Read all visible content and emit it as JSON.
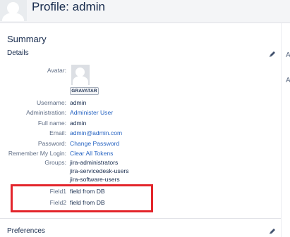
{
  "header": {
    "title": "Profile: admin",
    "avatar_icon": "user-avatar-icon"
  },
  "summary": {
    "heading": "Summary"
  },
  "details": {
    "heading": "Details",
    "edit_icon": "pencil-icon",
    "avatar_label": "Avatar:",
    "gravatar_button": "GRAVATAR",
    "username_label": "Username:",
    "username_value": "admin",
    "administration_label": "Administration:",
    "administration_value": "Administer User",
    "fullname_label": "Full name:",
    "fullname_value": "admin",
    "email_label": "Email:",
    "email_value": "admin@admin.com",
    "password_label": "Password:",
    "password_value": "Change Password",
    "remember_label": "Remember My Login:",
    "remember_value": "Clear All Tokens",
    "groups_label": "Groups:",
    "groups": [
      "jira-administrators",
      "jira-servicedesk-users",
      "jira-software-users"
    ],
    "field1_label": "Field1",
    "field1_value": "field from DB",
    "field2_label": "Field2",
    "field2_value": "field from DB",
    "highlight_color": "#e3252b"
  },
  "preferences": {
    "heading": "Preferences",
    "edit_icon": "pencil-icon"
  },
  "right_strip": {
    "marks": [
      "A",
      "A"
    ]
  },
  "colors": {
    "link": "#2764c2",
    "label": "#5e6c84",
    "text": "#172b4d",
    "header_bg": "#f4f5f7"
  }
}
